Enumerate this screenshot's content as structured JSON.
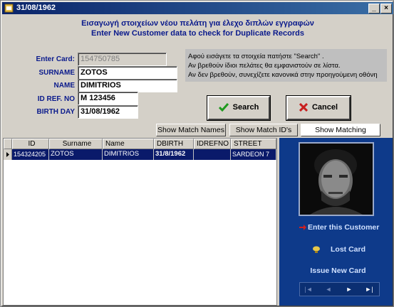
{
  "window": {
    "title": "31/08/1962",
    "controls": {
      "minimize": "_",
      "maximize": "□",
      "close": "×"
    }
  },
  "heading": {
    "greek": "Εισαγωγή στοιχείων νέου πελάτη για έλεχο διπλών εγγραφών",
    "english": "Enter New Customer data to check for Duplicate Records"
  },
  "form": {
    "card": {
      "label": "Enter Card:",
      "value": "154750785"
    },
    "surname": {
      "label": "SURNAME",
      "value": "ZOTOS"
    },
    "name": {
      "label": "NAME",
      "value": "DIMITRIOS"
    },
    "idref": {
      "label": "ID REF. NO",
      "value": "M 123456"
    },
    "birthday": {
      "label": "BIRTH DAY",
      "value": "31/08/1962"
    }
  },
  "info": {
    "line1": "Αφού εισάγετε τα στοιχεία πατήστε \"Search\" .",
    "line2": "Αν βρεθούν ίδιοι πελάτες θα εμφανιστούν σε λίστα.",
    "line3": "Αν δεν βρεθούν, συνεχίζετε κανονικά στην προηγούμενη οθόνη"
  },
  "buttons": {
    "search": "Search",
    "cancel": "Cancel",
    "show_match_names": "Show Match Names",
    "show_match_ids": "Show Match ID's",
    "show_matching_birthday": "Show Matching Birthday"
  },
  "grid": {
    "columns": [
      "ID",
      "Surname",
      "Name",
      "DBIRTH",
      "IDREFNO",
      "STREET"
    ],
    "rows": [
      {
        "id": "154324205",
        "surname": "ZOTOS",
        "name": "DIMITRIOS",
        "dbirth": "31/8/1962",
        "idrefno": "",
        "street": "SARDEON 7"
      }
    ]
  },
  "side": {
    "enter_customer": "Enter this Customer",
    "lost_card": "Lost Card",
    "issue_new_card": "Issue New Card",
    "nav": {
      "first": "|◄",
      "prev": "◄",
      "next": "►",
      "last": "►|"
    }
  },
  "colors": {
    "title_bar": "#0a246a",
    "heading_text": "#0a1a8c",
    "side_panel": "#0e3a8a",
    "selected_row": "#0a1a6a",
    "search_icon": "#1e9a1e",
    "cancel_icon": "#c81e1e"
  }
}
